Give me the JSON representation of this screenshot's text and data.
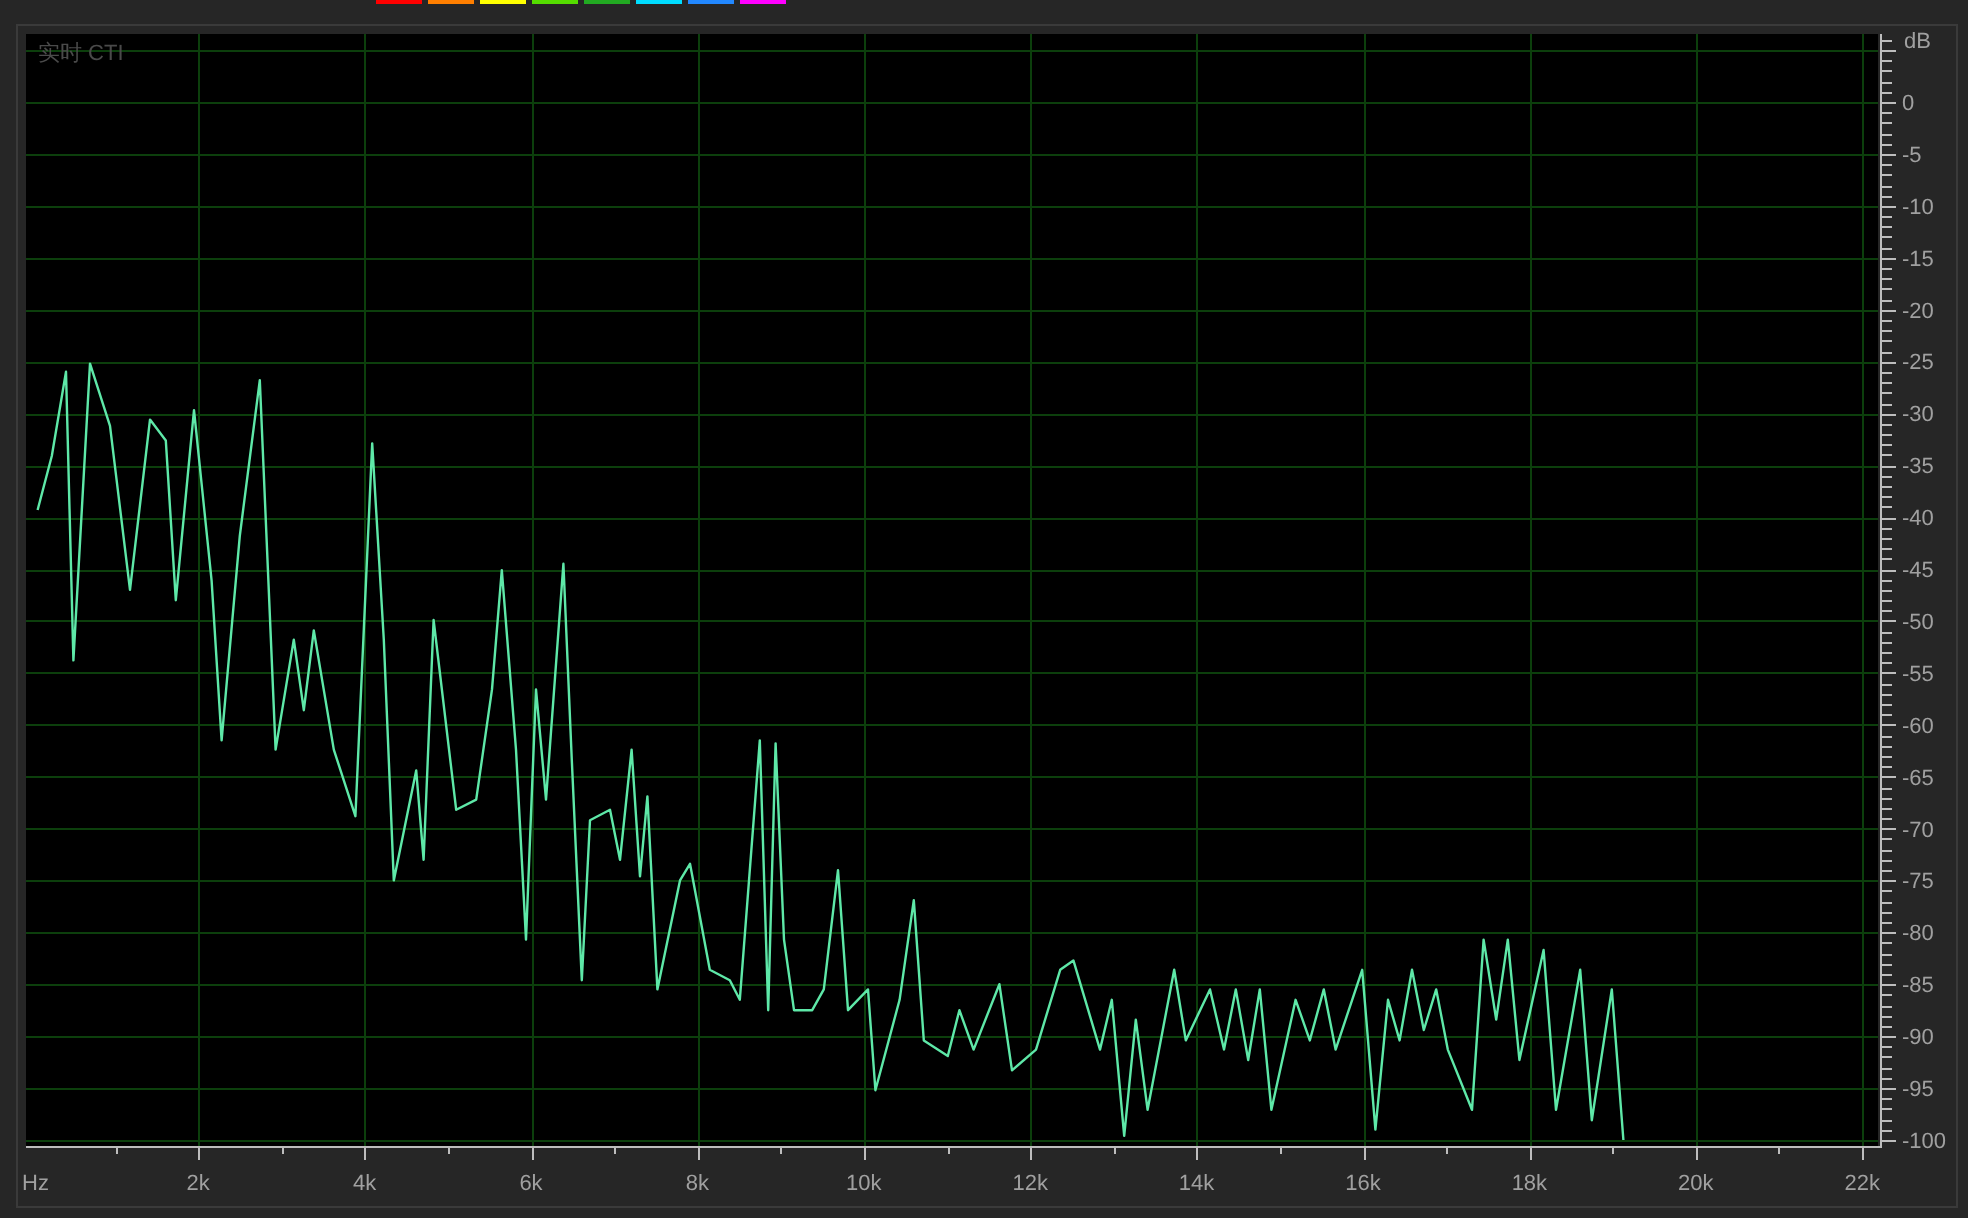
{
  "color_swatches": [
    {
      "color": "#ff0000"
    },
    {
      "color": "#ff7f00"
    },
    {
      "color": "#ffff00"
    },
    {
      "color": "#55dd00"
    },
    {
      "color": "#22aa22"
    },
    {
      "color": "#00ddff"
    },
    {
      "color": "#2288ff"
    },
    {
      "color": "#ff00ff"
    }
  ],
  "spectrum": {
    "overlay_label": "实时 CTI",
    "chart_data": {
      "type": "line",
      "xlabel": "Hz",
      "ylabel": "dB",
      "xlim": [
        -0.07,
        22.19
      ],
      "ylim": [
        -100.58,
        6.55
      ],
      "grid": true,
      "xticks": [
        {
          "value": 2,
          "label": "2k"
        },
        {
          "value": 4,
          "label": "4k"
        },
        {
          "value": 6,
          "label": "6k"
        },
        {
          "value": 8,
          "label": "8k"
        },
        {
          "value": 10,
          "label": "10k"
        },
        {
          "value": 12,
          "label": "12k"
        },
        {
          "value": 14,
          "label": "14k"
        },
        {
          "value": 16,
          "label": "16k"
        },
        {
          "value": 18,
          "label": "18k"
        },
        {
          "value": 20,
          "label": "20k"
        },
        {
          "value": 22,
          "label": "22k"
        }
      ],
      "yticks": [
        0,
        -5,
        -10,
        -15,
        -20,
        -25,
        -30,
        -35,
        -40,
        -45,
        -50,
        -55,
        -60,
        -65,
        -70,
        -75,
        -80,
        -85,
        -90,
        -95,
        -100
      ],
      "x": [
        0.07,
        0.24,
        0.41,
        0.5,
        0.7,
        0.94,
        1.18,
        1.42,
        1.61,
        1.73,
        1.95,
        2.16,
        2.28,
        2.5,
        2.74,
        2.93,
        3.15,
        3.27,
        3.39,
        3.63,
        3.89,
        4.09,
        4.23,
        4.35,
        4.62,
        4.71,
        4.83,
        5.1,
        5.34,
        5.53,
        5.65,
        5.82,
        5.94,
        6.06,
        6.18,
        6.39,
        6.49,
        6.61,
        6.71,
        6.95,
        7.07,
        7.21,
        7.31,
        7.4,
        7.52,
        7.79,
        7.91,
        8.15,
        8.39,
        8.51,
        8.75,
        8.85,
        8.94,
        9.04,
        9.16,
        9.38,
        9.52,
        9.69,
        9.81,
        10.05,
        10.14,
        10.43,
        10.6,
        10.72,
        11.01,
        11.15,
        11.32,
        11.63,
        11.78,
        12.07,
        12.36,
        12.52,
        12.84,
        12.98,
        13.13,
        13.27,
        13.41,
        13.73,
        13.87,
        14.16,
        14.33,
        14.47,
        14.62,
        14.76,
        14.9,
        15.19,
        15.36,
        15.53,
        15.67,
        15.99,
        16.15,
        16.3,
        16.44,
        16.59,
        16.73,
        16.88,
        17.02,
        17.31,
        17.45,
        17.6,
        17.74,
        17.88,
        18.17,
        18.32,
        18.61,
        18.75,
        18.99,
        19.13
      ],
      "series": [
        {
          "color": "#5ee8a8",
          "values": [
            -39.3,
            -34.1,
            -26.0,
            -53.8,
            -25.2,
            -31.2,
            -47.0,
            -30.6,
            -32.6,
            -48.0,
            -29.7,
            -46.1,
            -61.5,
            -41.8,
            -26.8,
            -62.4,
            -51.8,
            -58.6,
            -50.9,
            -62.4,
            -68.8,
            -32.9,
            -51.8,
            -75.0,
            -64.4,
            -73.0,
            -49.9,
            -68.2,
            -67.2,
            -56.6,
            -45.1,
            -62.4,
            -80.7,
            -56.6,
            -67.2,
            -44.5,
            -63.4,
            -84.6,
            -69.2,
            -68.2,
            -73.0,
            -62.4,
            -74.6,
            -66.9,
            -85.5,
            -75.0,
            -73.4,
            -83.6,
            -84.6,
            -86.5,
            -61.5,
            -87.5,
            -61.8,
            -80.7,
            -87.5,
            -87.5,
            -85.5,
            -74.0,
            -87.5,
            -85.5,
            -95.2,
            -86.5,
            -76.9,
            -90.4,
            -91.9,
            -87.5,
            -91.3,
            -85.0,
            -93.3,
            -91.3,
            -83.6,
            -82.7,
            -91.3,
            -86.5,
            -99.6,
            -88.4,
            -97.1,
            -83.6,
            -90.4,
            -85.5,
            -91.3,
            -85.5,
            -92.3,
            -85.5,
            -97.1,
            -86.5,
            -90.4,
            -85.5,
            -91.3,
            -83.6,
            -99.0,
            -86.5,
            -90.4,
            -83.6,
            -89.4,
            -85.5,
            -91.3,
            -97.1,
            -80.7,
            -88.4,
            -80.7,
            -92.3,
            -81.7,
            -97.1,
            -83.6,
            -98.1,
            -85.5,
            -100
          ]
        }
      ]
    }
  }
}
